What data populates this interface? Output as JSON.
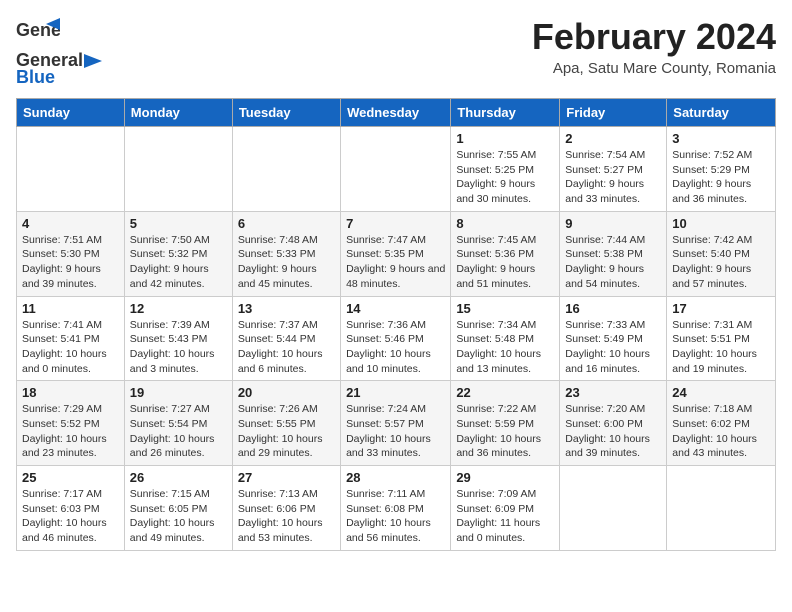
{
  "header": {
    "logo_general": "General",
    "logo_blue": "Blue",
    "month_title": "February 2024",
    "location": "Apa, Satu Mare County, Romania"
  },
  "weekdays": [
    "Sunday",
    "Monday",
    "Tuesday",
    "Wednesday",
    "Thursday",
    "Friday",
    "Saturday"
  ],
  "weeks": [
    [
      {
        "day": "",
        "info": ""
      },
      {
        "day": "",
        "info": ""
      },
      {
        "day": "",
        "info": ""
      },
      {
        "day": "",
        "info": ""
      },
      {
        "day": "1",
        "info": "Sunrise: 7:55 AM\nSunset: 5:25 PM\nDaylight: 9 hours and 30 minutes."
      },
      {
        "day": "2",
        "info": "Sunrise: 7:54 AM\nSunset: 5:27 PM\nDaylight: 9 hours and 33 minutes."
      },
      {
        "day": "3",
        "info": "Sunrise: 7:52 AM\nSunset: 5:29 PM\nDaylight: 9 hours and 36 minutes."
      }
    ],
    [
      {
        "day": "4",
        "info": "Sunrise: 7:51 AM\nSunset: 5:30 PM\nDaylight: 9 hours and 39 minutes."
      },
      {
        "day": "5",
        "info": "Sunrise: 7:50 AM\nSunset: 5:32 PM\nDaylight: 9 hours and 42 minutes."
      },
      {
        "day": "6",
        "info": "Sunrise: 7:48 AM\nSunset: 5:33 PM\nDaylight: 9 hours and 45 minutes."
      },
      {
        "day": "7",
        "info": "Sunrise: 7:47 AM\nSunset: 5:35 PM\nDaylight: 9 hours and 48 minutes."
      },
      {
        "day": "8",
        "info": "Sunrise: 7:45 AM\nSunset: 5:36 PM\nDaylight: 9 hours and 51 minutes."
      },
      {
        "day": "9",
        "info": "Sunrise: 7:44 AM\nSunset: 5:38 PM\nDaylight: 9 hours and 54 minutes."
      },
      {
        "day": "10",
        "info": "Sunrise: 7:42 AM\nSunset: 5:40 PM\nDaylight: 9 hours and 57 minutes."
      }
    ],
    [
      {
        "day": "11",
        "info": "Sunrise: 7:41 AM\nSunset: 5:41 PM\nDaylight: 10 hours and 0 minutes."
      },
      {
        "day": "12",
        "info": "Sunrise: 7:39 AM\nSunset: 5:43 PM\nDaylight: 10 hours and 3 minutes."
      },
      {
        "day": "13",
        "info": "Sunrise: 7:37 AM\nSunset: 5:44 PM\nDaylight: 10 hours and 6 minutes."
      },
      {
        "day": "14",
        "info": "Sunrise: 7:36 AM\nSunset: 5:46 PM\nDaylight: 10 hours and 10 minutes."
      },
      {
        "day": "15",
        "info": "Sunrise: 7:34 AM\nSunset: 5:48 PM\nDaylight: 10 hours and 13 minutes."
      },
      {
        "day": "16",
        "info": "Sunrise: 7:33 AM\nSunset: 5:49 PM\nDaylight: 10 hours and 16 minutes."
      },
      {
        "day": "17",
        "info": "Sunrise: 7:31 AM\nSunset: 5:51 PM\nDaylight: 10 hours and 19 minutes."
      }
    ],
    [
      {
        "day": "18",
        "info": "Sunrise: 7:29 AM\nSunset: 5:52 PM\nDaylight: 10 hours and 23 minutes."
      },
      {
        "day": "19",
        "info": "Sunrise: 7:27 AM\nSunset: 5:54 PM\nDaylight: 10 hours and 26 minutes."
      },
      {
        "day": "20",
        "info": "Sunrise: 7:26 AM\nSunset: 5:55 PM\nDaylight: 10 hours and 29 minutes."
      },
      {
        "day": "21",
        "info": "Sunrise: 7:24 AM\nSunset: 5:57 PM\nDaylight: 10 hours and 33 minutes."
      },
      {
        "day": "22",
        "info": "Sunrise: 7:22 AM\nSunset: 5:59 PM\nDaylight: 10 hours and 36 minutes."
      },
      {
        "day": "23",
        "info": "Sunrise: 7:20 AM\nSunset: 6:00 PM\nDaylight: 10 hours and 39 minutes."
      },
      {
        "day": "24",
        "info": "Sunrise: 7:18 AM\nSunset: 6:02 PM\nDaylight: 10 hours and 43 minutes."
      }
    ],
    [
      {
        "day": "25",
        "info": "Sunrise: 7:17 AM\nSunset: 6:03 PM\nDaylight: 10 hours and 46 minutes."
      },
      {
        "day": "26",
        "info": "Sunrise: 7:15 AM\nSunset: 6:05 PM\nDaylight: 10 hours and 49 minutes."
      },
      {
        "day": "27",
        "info": "Sunrise: 7:13 AM\nSunset: 6:06 PM\nDaylight: 10 hours and 53 minutes."
      },
      {
        "day": "28",
        "info": "Sunrise: 7:11 AM\nSunset: 6:08 PM\nDaylight: 10 hours and 56 minutes."
      },
      {
        "day": "29",
        "info": "Sunrise: 7:09 AM\nSunset: 6:09 PM\nDaylight: 11 hours and 0 minutes."
      },
      {
        "day": "",
        "info": ""
      },
      {
        "day": "",
        "info": ""
      }
    ]
  ]
}
